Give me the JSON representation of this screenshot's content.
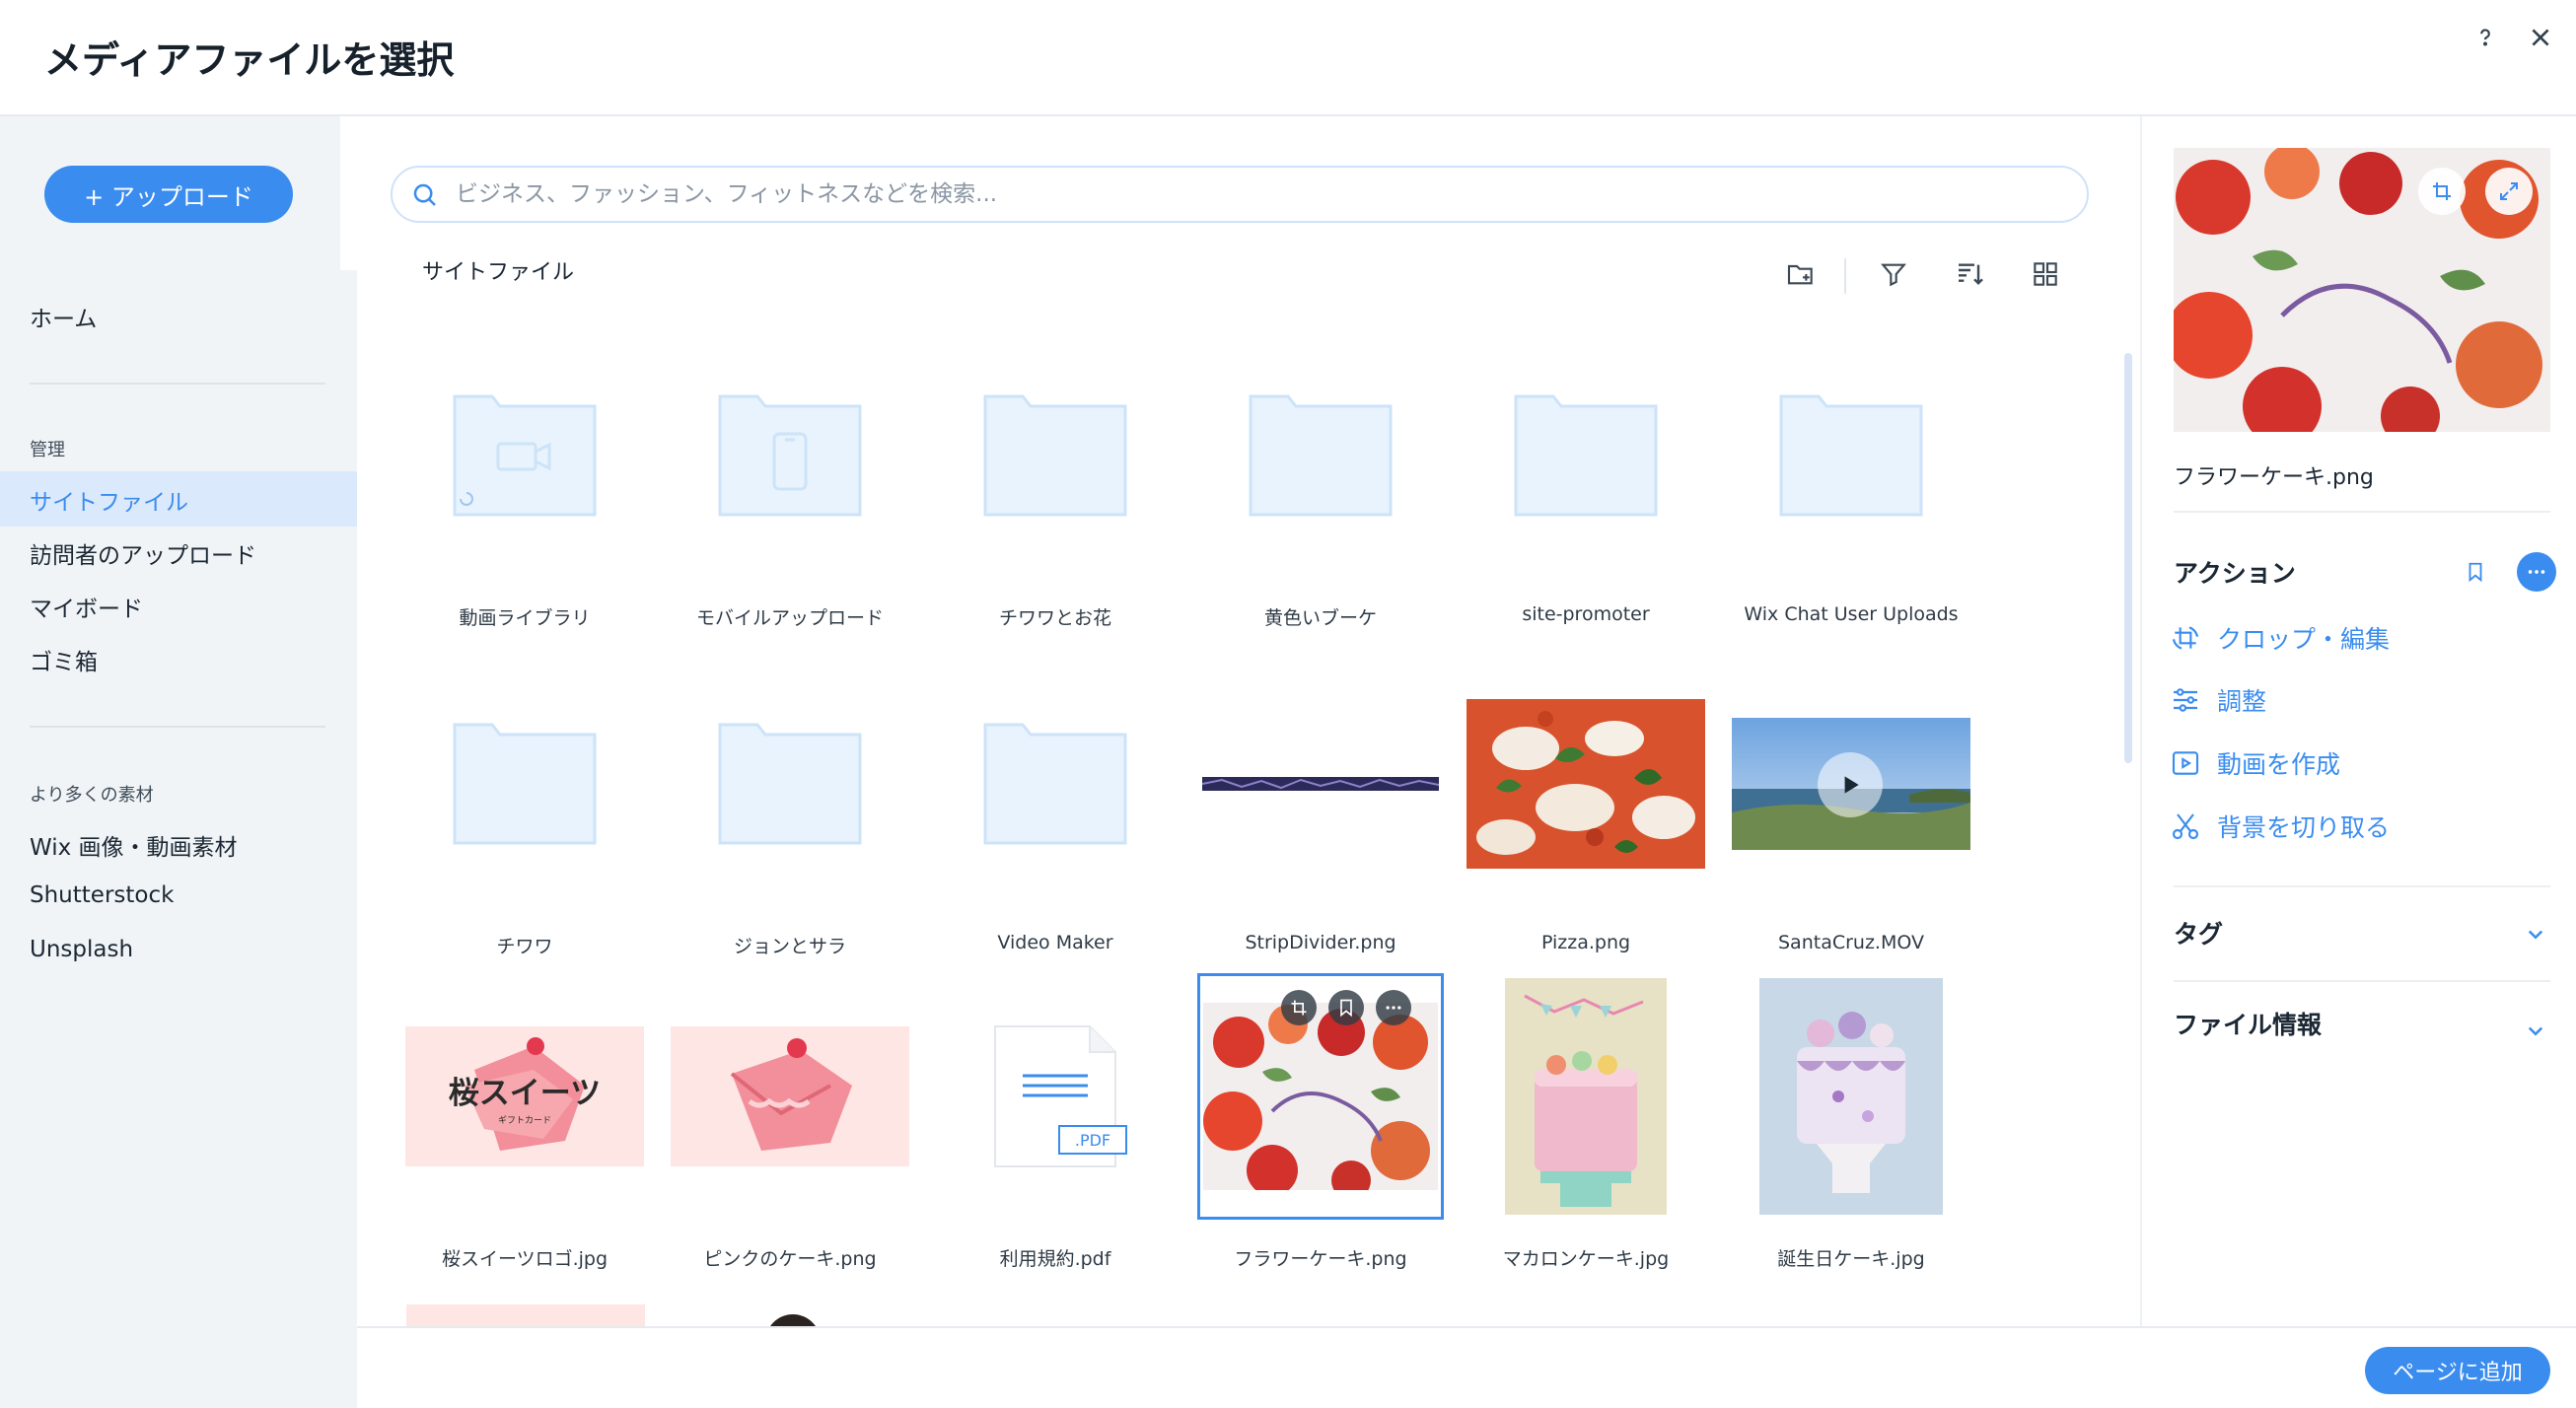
{
  "header": {
    "title": "メディアファイルを選択",
    "help_icon": "question-icon",
    "close_icon": "close-icon"
  },
  "sidebar": {
    "upload_label": "+ アップロード",
    "home_label": "ホーム",
    "manage_section": "管理",
    "manage_items": [
      "サイトファイル",
      "訪問者のアップロード",
      "マイボード",
      "ゴミ箱"
    ],
    "active_item": "サイトファイル",
    "more_section": "より多くの素材",
    "more_items": [
      "Wix 画像・動画素材",
      "Shutterstock",
      "Unsplash"
    ]
  },
  "search": {
    "placeholder": "ビジネス、ファッション、フィットネスなどを検索...",
    "value": ""
  },
  "breadcrumb": "サイトファイル",
  "toolbar": {
    "icons": [
      "new-folder-icon",
      "filter-icon",
      "sort-icon",
      "grid-view-icon"
    ]
  },
  "grid": {
    "row1": [
      "動画ライブラリ",
      "モバイルアップロード",
      "チワワとお花",
      "黄色いブーケ",
      "site-promoter",
      "Wix Chat User Uploads"
    ],
    "row2": [
      "チワワ",
      "ジョンとサラ",
      "Video Maker",
      "StripDivider.png",
      "Pizza.png",
      "SantaCruz.MOV"
    ],
    "row3": [
      "桜スイーツロゴ.jpg",
      "ピンクのケーキ.png",
      "利用規約.pdf",
      "フラワーケーキ.png",
      "マカロンケーキ.jpg",
      "誕生日ケーキ.jpg"
    ],
    "sakura_logo_text": "桜スイーツ",
    "sakura_logo_sub": "ギフトカード",
    "pdf_badge": ".PDF"
  },
  "footer": {
    "add_label": "ページに追加"
  },
  "right_panel": {
    "filename": "フラワーケーキ.png",
    "actions_heading": "アクション",
    "actions": [
      "クロップ・編集",
      "調整",
      "動画を作成",
      "背景を切り取る"
    ],
    "tags_heading": "タグ",
    "file_info_heading": "ファイル情報"
  },
  "colors": {
    "accent": "#3a8cef",
    "folder": "#e8f3fd",
    "folder_stroke": "#cde3f8",
    "sidebar_bg": "#f1f4f7",
    "active_bg": "#dbe9fc"
  }
}
